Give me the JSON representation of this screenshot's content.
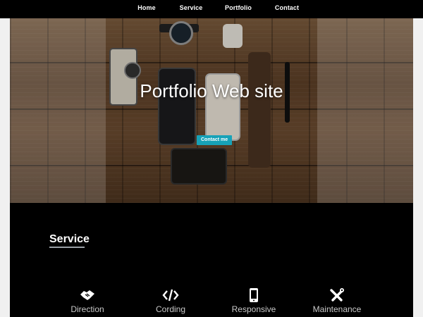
{
  "nav": {
    "items": [
      {
        "label": "Home"
      },
      {
        "label": "Service"
      },
      {
        "label": "Portfolio"
      },
      {
        "label": "Contact"
      }
    ]
  },
  "hero": {
    "title": "Portfolio Web site",
    "button_label": "Contact me"
  },
  "service_section": {
    "title": "Service",
    "items": [
      {
        "label": "Direction",
        "icon": "handshake-icon"
      },
      {
        "label": "Cording",
        "icon": "code-icon"
      },
      {
        "label": "Responsive",
        "icon": "mobile-icon"
      },
      {
        "label": "Maintenance",
        "icon": "tools-icon"
      }
    ]
  },
  "colors": {
    "background": "#000000",
    "accent": "#17a2b8",
    "text": "#ffffff"
  }
}
